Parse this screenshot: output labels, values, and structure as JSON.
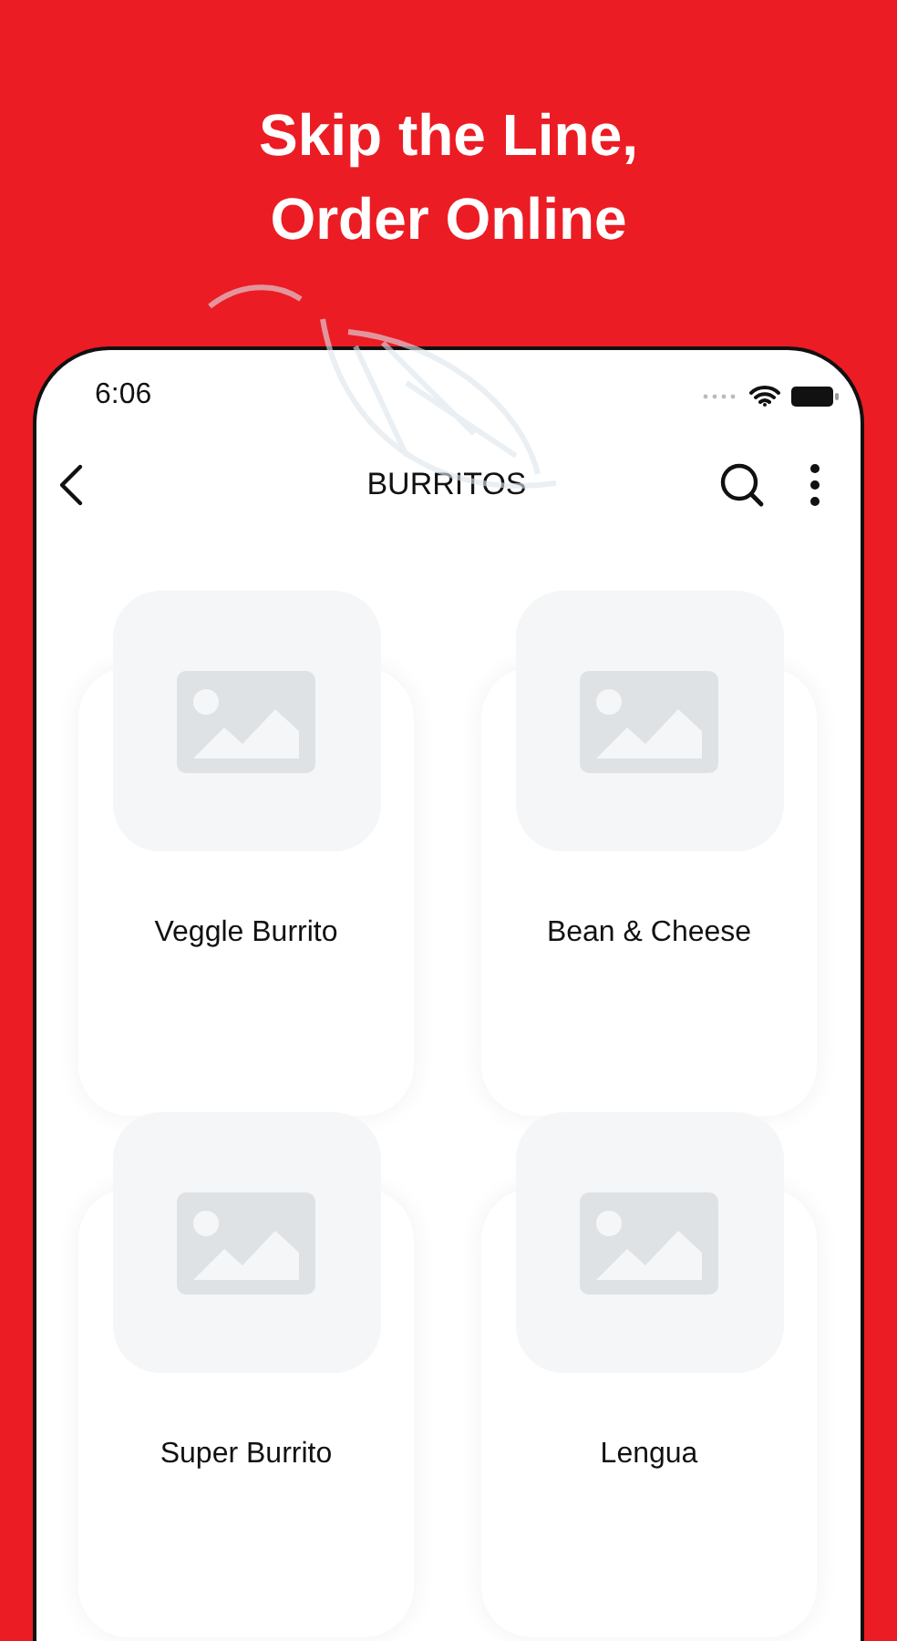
{
  "headline": [
    "Skip the Line,",
    "Order Online"
  ],
  "status_bar": {
    "time": "6:06"
  },
  "nav": {
    "title": "BURRITOS"
  },
  "items": [
    {
      "name": "Veggle Burrito"
    },
    {
      "name": "Bean & Cheese"
    },
    {
      "name": "Super Burrito"
    },
    {
      "name": "Lengua"
    }
  ]
}
